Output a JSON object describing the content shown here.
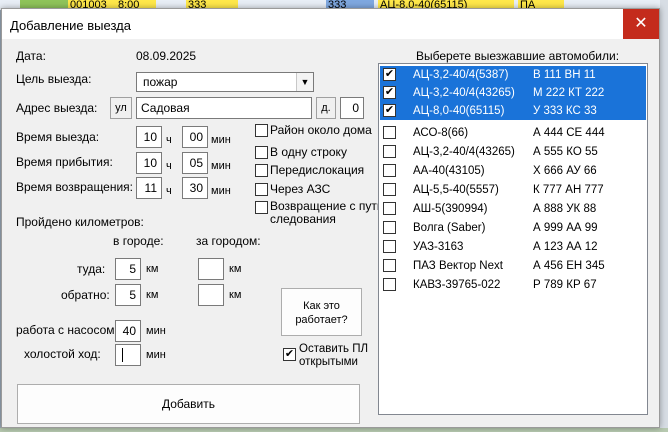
{
  "background": {
    "cells": [
      "001003",
      "8:00",
      "333",
      "333",
      "АЦ-8,0-40(65115)",
      "ПА"
    ]
  },
  "dialog": {
    "title": "Добавление выезда",
    "close_glyph": "✕"
  },
  "date": {
    "label": "Дата:",
    "value": "08.09.2025"
  },
  "purpose": {
    "label": "Цель выезда:",
    "value": "пожар"
  },
  "address": {
    "label": "Адрес выезда:",
    "street_prefix": "ул",
    "street": "Садовая",
    "house_prefix": "д.",
    "house": "0"
  },
  "times": {
    "hour_unit": "ч",
    "min_unit": "мин",
    "departure": {
      "label": "Время выезда:",
      "h": "10",
      "m": "00"
    },
    "arrival": {
      "label": "Время прибытия:",
      "h": "10",
      "m": "05"
    },
    "return": {
      "label": "Время возвращения:",
      "h": "11",
      "m": "30"
    }
  },
  "options": [
    {
      "label": "Район около дома",
      "checked": false
    },
    {
      "label": "В одну строку",
      "checked": false
    },
    {
      "label": "Передислокация",
      "checked": false
    },
    {
      "label": "Через АЗС",
      "checked": false
    },
    {
      "label": "Возвращение с пути\nследования",
      "checked": false
    }
  ],
  "km": {
    "title": "Пройдено километров:",
    "city_header": "в городе:",
    "outside_header": "за городом:",
    "unit": "км",
    "there": {
      "label": "туда:",
      "city": "5",
      "outside": ""
    },
    "back": {
      "label": "обратно:",
      "city": "5",
      "outside": ""
    }
  },
  "pump": {
    "label": "работа с насосом:",
    "value": "40",
    "unit": "мин"
  },
  "idle": {
    "label": "холостой ход:",
    "value": "",
    "unit": "мин"
  },
  "help_button": "Как это\nработает?",
  "keep_open": {
    "label": "Оставить ПЛ\nоткрытыми",
    "checked": true
  },
  "add_button": "Добавить",
  "vehicles": {
    "title": "Выберете выезжавшие автомобили:",
    "items": [
      {
        "name": "АЦ-3,2-40/4(5387)",
        "plate": "В 111 ВН 11",
        "checked": true
      },
      {
        "name": "АЦ-3,2-40/4(43265)",
        "plate": "М 222 КТ 222",
        "checked": true
      },
      {
        "name": "АЦ-8,0-40(65115)",
        "plate": "У 333 КС 33",
        "checked": true
      },
      {
        "name": "АСО-8(66)",
        "plate": "А 444 СЕ 444",
        "checked": false
      },
      {
        "name": "АЦ-3,2-40/4(43265)",
        "plate": "А 555 КО 55",
        "checked": false
      },
      {
        "name": "АА-40(43105)",
        "plate": "Х 666 АУ 66",
        "checked": false
      },
      {
        "name": "АЦ-5,5-40(5557)",
        "plate": "К 777 АН 777",
        "checked": false
      },
      {
        "name": "АШ-5(390994)",
        "plate": "А 888 УК 88",
        "checked": false
      },
      {
        "name": "Волга (Saber)",
        "plate": "А 999 АА 99",
        "checked": false
      },
      {
        "name": "УАЗ-3163",
        "plate": "А 123 АА 12",
        "checked": false
      },
      {
        "name": "ПАЗ Вектор Next",
        "plate": "А 456 ЕН 345",
        "checked": false
      },
      {
        "name": "КАВЗ-39765-022",
        "plate": "Р 789 КР 67",
        "checked": false
      }
    ]
  },
  "colors": {
    "selection": "#1a73d9",
    "close_button": "#c42b1c"
  }
}
